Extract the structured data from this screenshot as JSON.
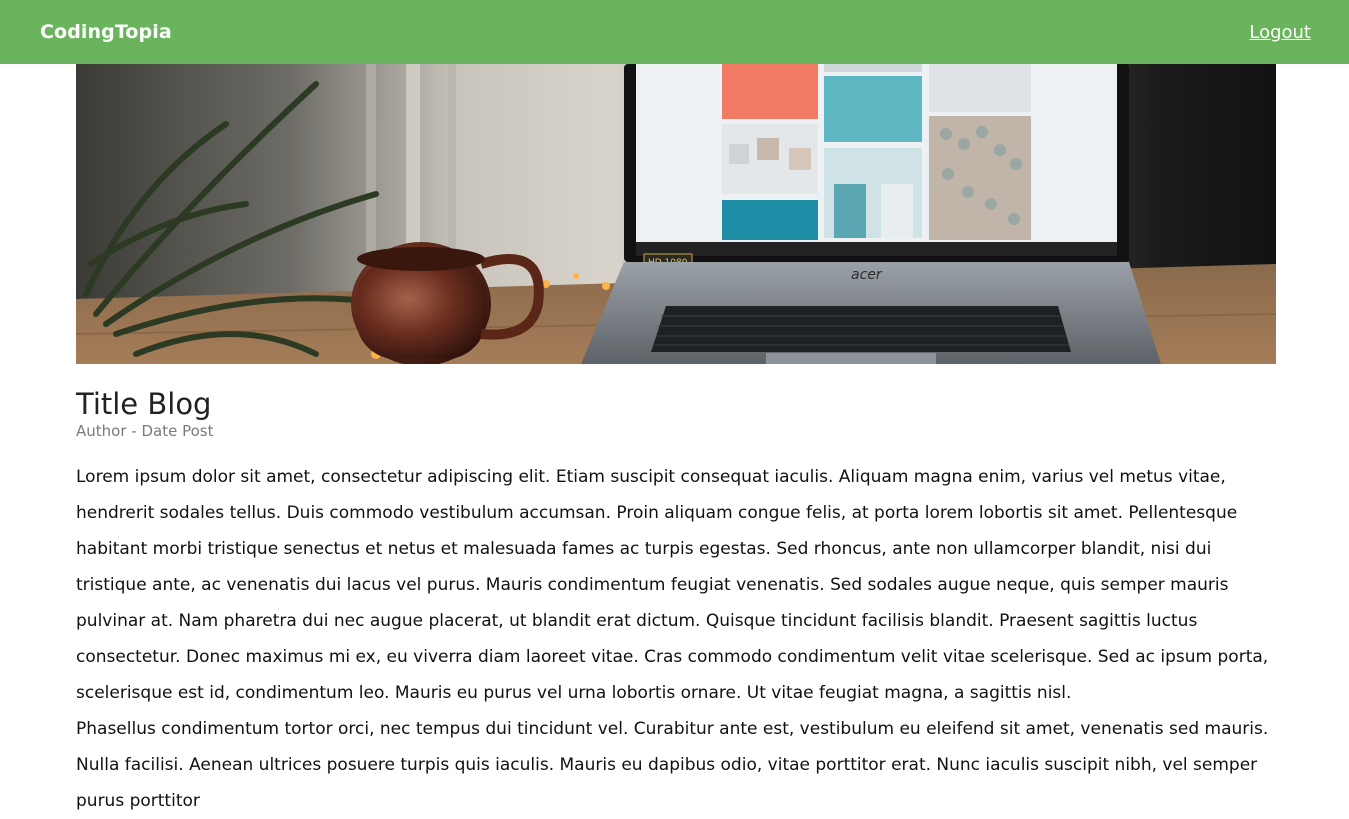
{
  "navbar": {
    "brand": "CodingTopia",
    "logout_label": "Logout",
    "color": "#69b45c"
  },
  "hero": {
    "image_kind": "laptop-desk-photo",
    "laptop_brand": "acer",
    "hd_badge": "HD 1080"
  },
  "post": {
    "title": "Title Blog",
    "meta": "Author - Date Post",
    "paragraphs": [
      "Lorem ipsum dolor sit amet, consectetur adipiscing elit. Etiam suscipit consequat iaculis. Aliquam magna enim, varius vel metus vitae, hendrerit sodales tellus. Duis commodo vestibulum accumsan. Proin aliquam congue felis, at porta lorem lobortis sit amet. Pellentesque habitant morbi tristique senectus et netus et malesuada fames ac turpis egestas. Sed rhoncus, ante non ullamcorper blandit, nisi dui tristique ante, ac venenatis dui lacus vel purus. Mauris condimentum feugiat venenatis. Sed sodales augue neque, quis semper mauris pulvinar at. Nam pharetra dui nec augue placerat, ut blandit erat dictum. Quisque tincidunt facilisis blandit. Praesent sagittis luctus consectetur. Donec maximus mi ex, eu viverra diam laoreet vitae. Cras commodo condimentum velit vitae scelerisque. Sed ac ipsum porta, scelerisque est id, condimentum leo. Mauris eu purus vel urna lobortis ornare. Ut vitae feugiat magna, a sagittis nisl.",
      "Phasellus condimentum tortor orci, nec tempus dui tincidunt vel. Curabitur ante est, vestibulum eu eleifend sit amet, venenatis sed mauris. Nulla facilisi. Aenean ultrices posuere turpis quis iaculis. Mauris eu dapibus odio, vitae porttitor erat. Nunc iaculis suscipit nibh, vel semper purus porttitor"
    ]
  }
}
